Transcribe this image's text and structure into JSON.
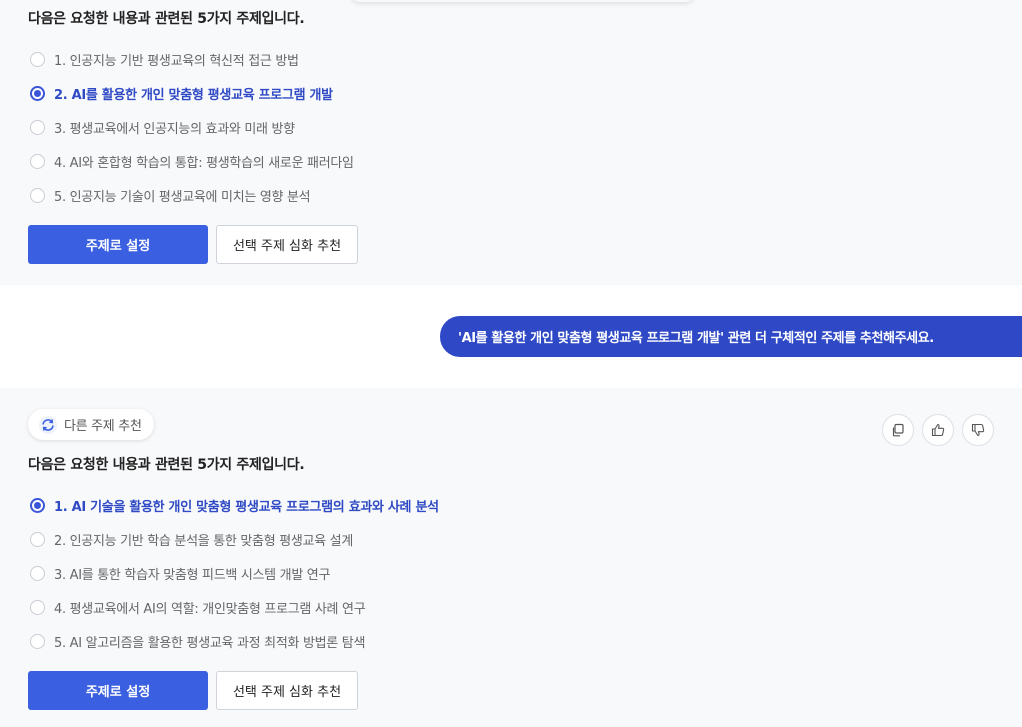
{
  "panel1": {
    "intro": "다음은 요청한 내용과 관련된 5가지 주제입니다.",
    "options": [
      {
        "label": "1. 인공지능 기반 평생교육의 혁신적 접근 방법",
        "selected": false
      },
      {
        "label": "2. AI를 활용한 개인 맞춤형 평생교육 프로그램 개발",
        "selected": true
      },
      {
        "label": "3. 평생교육에서 인공지능의 효과와 미래 방향",
        "selected": false
      },
      {
        "label": "4. AI와 혼합형 학습의 통합: 평생학습의 새로운 패러다임",
        "selected": false
      },
      {
        "label": "5. 인공지능 기술이 평생교육에 미치는 영향 분석",
        "selected": false
      }
    ],
    "set_topic_label": "주제로 설정",
    "deep_recommend_label": "선택 주제 심화 추천"
  },
  "user_message": "'AI를 활용한 개인 맞춤형 평생교육 프로그램 개발' 관련 더 구체적인 주제를 추천해주세요.",
  "panel2": {
    "recommend_chip_label": "다른 주제 추천",
    "actions": [
      "copy-icon",
      "thumbs-up-icon",
      "thumbs-down-icon"
    ],
    "intro": "다음은 요청한 내용과 관련된 5가지 주제입니다.",
    "options": [
      {
        "label": "1. AI 기술을 활용한 개인 맞춤형 평생교육 프로그램의 효과와 사례 분석",
        "selected": true
      },
      {
        "label": "2. 인공지능 기반 학습 분석을 통한 맞춤형 평생교육 설계",
        "selected": false
      },
      {
        "label": "3. AI를 통한 학습자 맞춤형 피드백 시스템 개발 연구",
        "selected": false
      },
      {
        "label": "4. 평생교육에서 AI의 역할: 개인맞춤형 프로그램 사례 연구",
        "selected": false
      },
      {
        "label": "5. AI 알고리즘을 활용한 평생교육 과정 최적화 방법론 탐색",
        "selected": false
      }
    ],
    "set_topic_label": "주제로 설정",
    "deep_recommend_label": "선택 주제 심화 추천"
  },
  "colors": {
    "accent": "#3a5fe0",
    "selected_text": "#2f4ac4",
    "user_bubble": "#2f49c6",
    "panel_bg": "#f8f9fb"
  }
}
